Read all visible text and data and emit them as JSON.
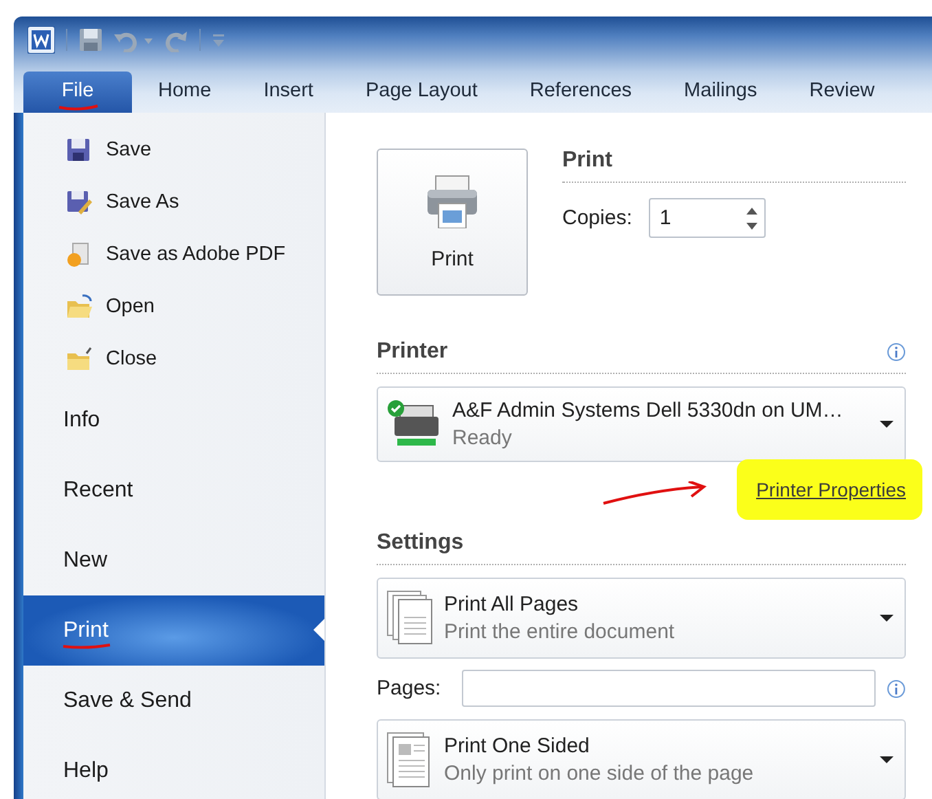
{
  "tabs": [
    {
      "label": "File",
      "selected": true,
      "underlined": true
    },
    {
      "label": "Home",
      "selected": false,
      "underlined": false
    },
    {
      "label": "Insert",
      "selected": false,
      "underlined": false
    },
    {
      "label": "Page Layout",
      "selected": false,
      "underlined": false
    },
    {
      "label": "References",
      "selected": false,
      "underlined": false
    },
    {
      "label": "Mailings",
      "selected": false,
      "underlined": false
    },
    {
      "label": "Review",
      "selected": false,
      "underlined": false
    }
  ],
  "menu": [
    {
      "label": "Save",
      "kind": "command",
      "selected": false,
      "underlined": false
    },
    {
      "label": "Save As",
      "kind": "command",
      "selected": false,
      "underlined": false
    },
    {
      "label": "Save as Adobe PDF",
      "kind": "command",
      "selected": false,
      "underlined": false
    },
    {
      "label": "Open",
      "kind": "command",
      "selected": false,
      "underlined": false
    },
    {
      "label": "Close",
      "kind": "command",
      "selected": false,
      "underlined": false
    },
    {
      "label": "Info",
      "kind": "section",
      "selected": false,
      "underlined": false
    },
    {
      "label": "Recent",
      "kind": "section",
      "selected": false,
      "underlined": false
    },
    {
      "label": "New",
      "kind": "section",
      "selected": false,
      "underlined": false
    },
    {
      "label": "Print",
      "kind": "section",
      "selected": true,
      "underlined": true
    },
    {
      "label": "Save & Send",
      "kind": "section",
      "selected": false,
      "underlined": false
    },
    {
      "label": "Help",
      "kind": "section",
      "selected": false,
      "underlined": false
    }
  ],
  "print": {
    "title": "Print",
    "button": "Print",
    "copies_label": "Copies:",
    "copies": "1"
  },
  "printer": {
    "title": "Printer",
    "name": "A&F Admin Systems Dell 5330dn on UM…",
    "status": "Ready",
    "properties_link": "Printer Properties",
    "link_highlighted": true,
    "arrow": true
  },
  "settings": {
    "title": "Settings",
    "items": [
      {
        "kind": "dropdown",
        "title": "Print All Pages",
        "subtitle": "Print the entire document"
      },
      {
        "kind": "field",
        "label": "Pages:"
      },
      {
        "kind": "dropdown",
        "title": "Print One Sided",
        "subtitle": "Only print on one side of the page"
      }
    ]
  }
}
